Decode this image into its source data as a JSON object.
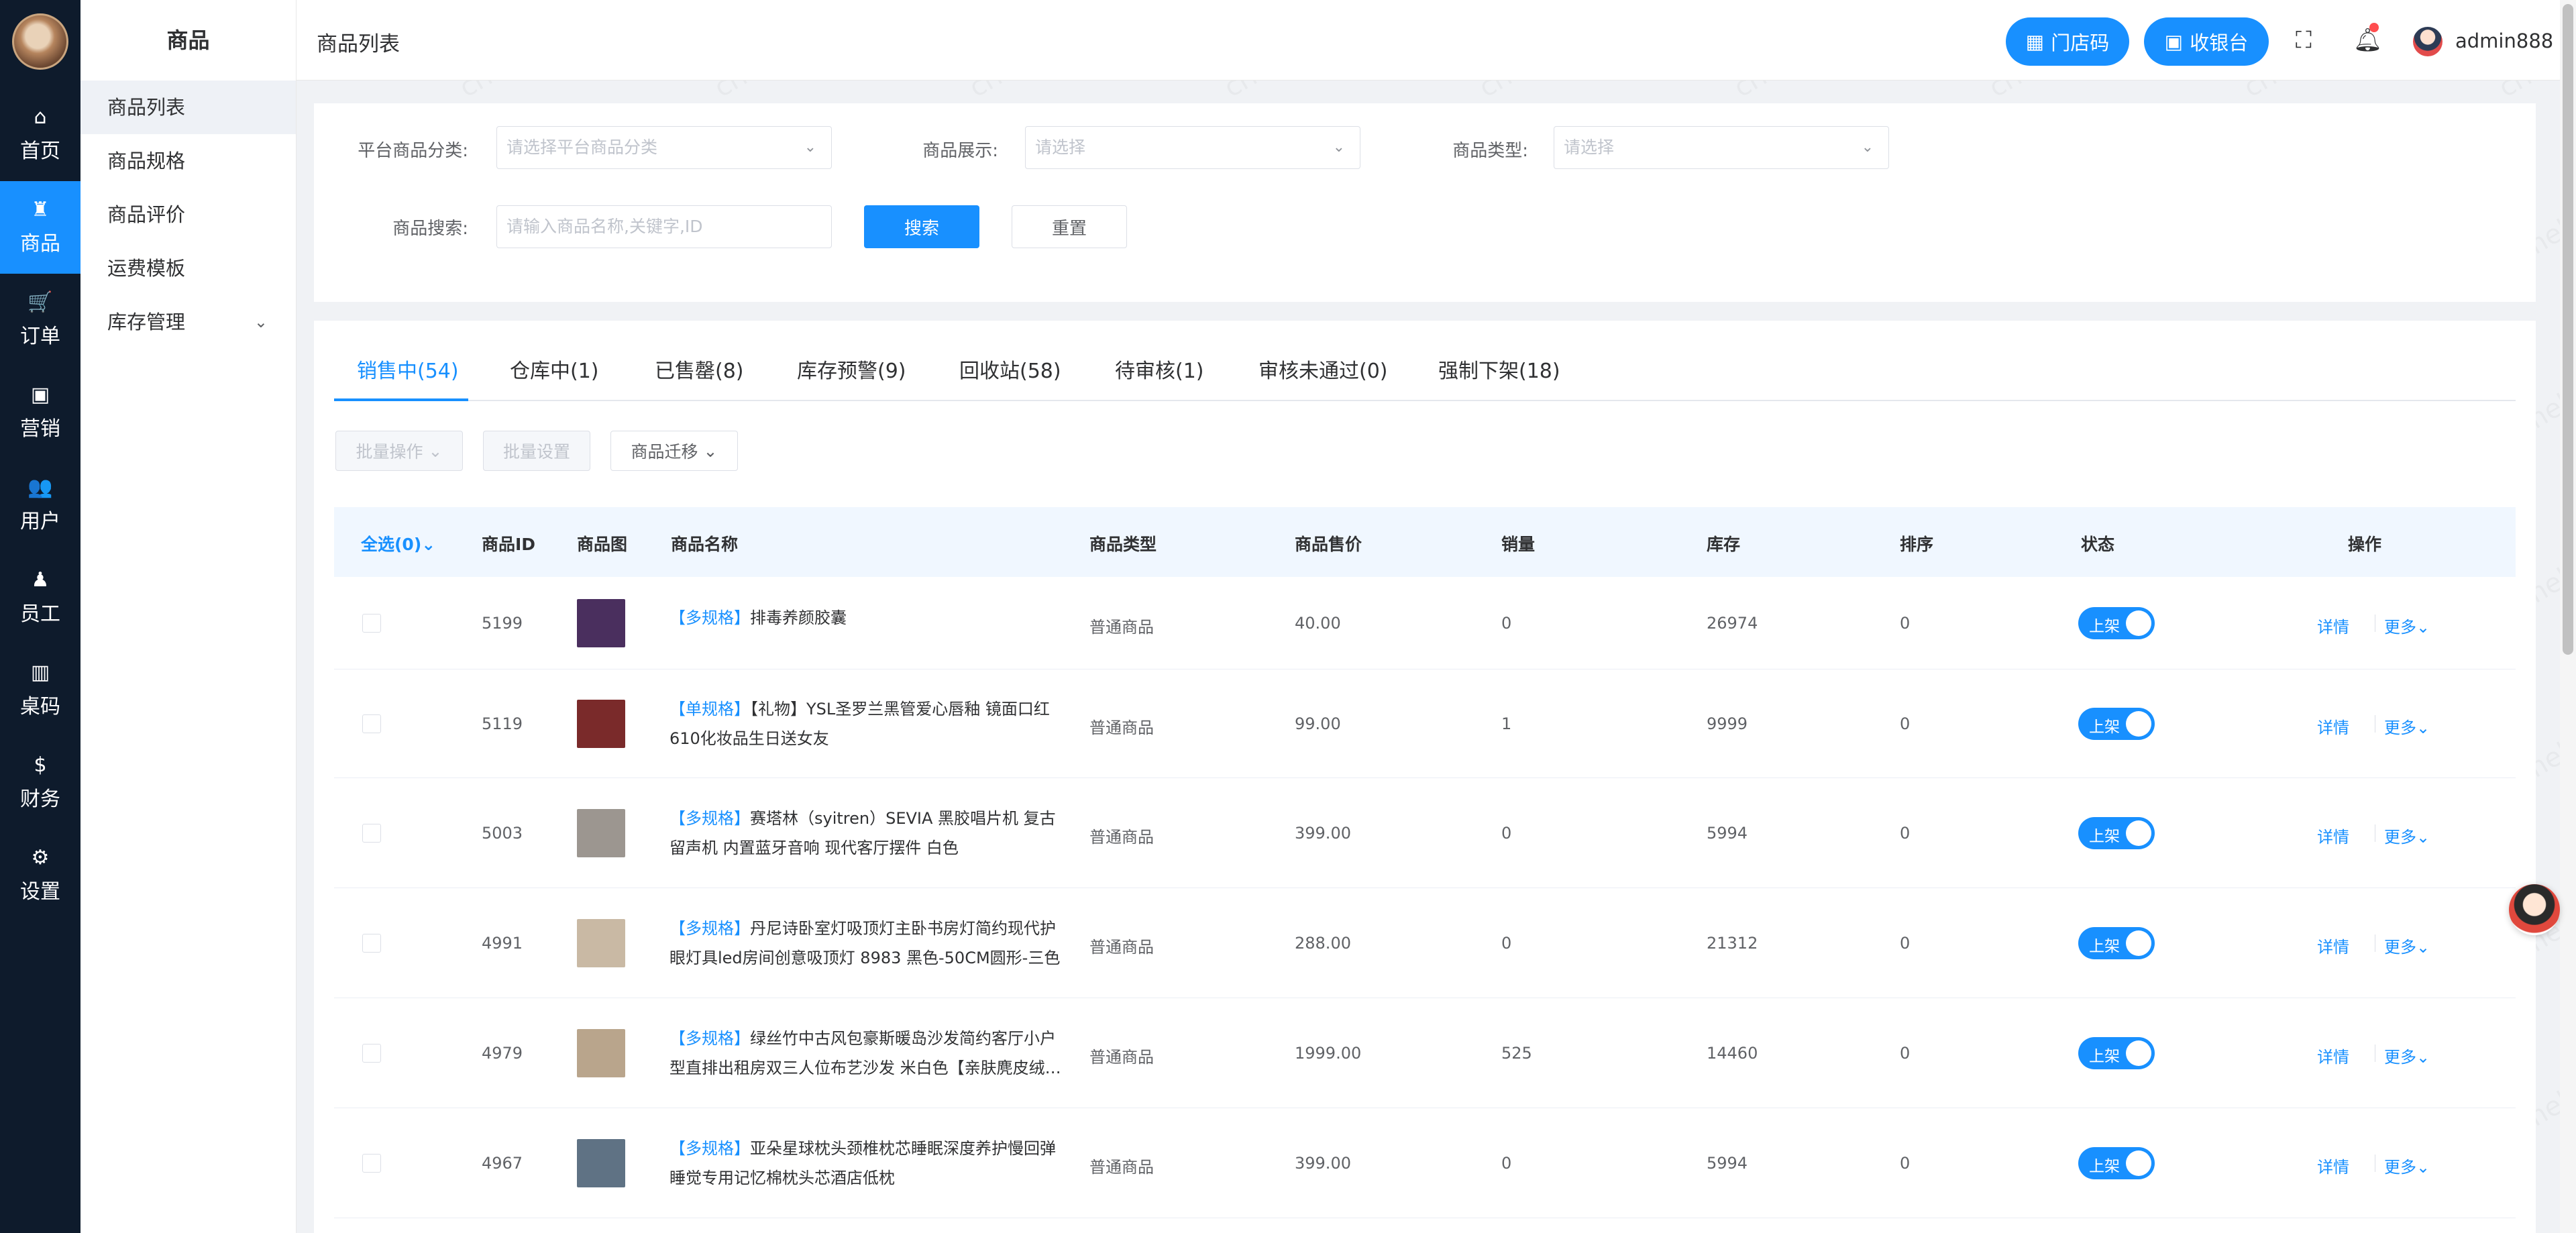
{
  "main_nav": {
    "items": [
      {
        "label": "首页",
        "icon": "⌂"
      },
      {
        "label": "商品",
        "icon": "♜"
      },
      {
        "label": "订单",
        "icon": "🛒"
      },
      {
        "label": "营销",
        "icon": "▣"
      },
      {
        "label": "用户",
        "icon": "👥"
      },
      {
        "label": "员工",
        "icon": "♟"
      },
      {
        "label": "桌码",
        "icon": "▥"
      },
      {
        "label": "财务",
        "icon": "$"
      },
      {
        "label": "设置",
        "icon": "⚙"
      }
    ],
    "active": "商品"
  },
  "sub_nav": {
    "title": "商品",
    "items": [
      "商品列表",
      "商品规格",
      "商品评价",
      "运费模板",
      "库存管理"
    ]
  },
  "header": {
    "breadcrumb": "商品列表",
    "store_code_label": "门店码",
    "cashier_label": "收银台",
    "username": "admin888"
  },
  "filters": {
    "category_label": "平台商品分类:",
    "category_placeholder": "请选择平台商品分类",
    "display_label": "商品展示:",
    "display_placeholder": "请选择",
    "type_label": "商品类型:",
    "type_placeholder": "请选择",
    "search_label": "商品搜索:",
    "search_placeholder": "请输入商品名称,关键字,ID",
    "search_button": "搜索",
    "reset_button": "重置"
  },
  "tabs": [
    "销售中(54)",
    "仓库中(1)",
    "已售罄(8)",
    "库存预警(9)",
    "回收站(58)",
    "待审核(1)",
    "审核未通过(0)",
    "强制下架(18)"
  ],
  "actions": {
    "batch_op": "批量操作",
    "batch_set": "批量设置",
    "migrate": "商品迁移"
  },
  "table": {
    "headers": [
      "全选(0)",
      "商品ID",
      "商品图",
      "商品名称",
      "商品类型",
      "商品售价",
      "销量",
      "库存",
      "排序",
      "状态",
      "操作"
    ],
    "rows": [
      {
        "id": "5199",
        "tag": "【多规格】",
        "name": "排毒养颜胶囊",
        "type": "普通商品",
        "price": "40.00",
        "sales": "0",
        "stock": "26974",
        "sort": "0",
        "status": "上架",
        "thumb_color": "#4a2f5e"
      },
      {
        "id": "5119",
        "tag": "【单规格】",
        "name": "【礼物】YSL圣罗兰黑管爱心唇釉 镜面口红610化妆品生日送女友",
        "type": "普通商品",
        "price": "99.00",
        "sales": "1",
        "stock": "9999",
        "sort": "0",
        "status": "上架",
        "thumb_color": "#7a2a2a"
      },
      {
        "id": "5003",
        "tag": "【多规格】",
        "name": "赛塔林（syitren）SEVIA 黑胶唱片机 复古留声机 内置蓝牙音响 现代客厅摆件 白色",
        "type": "普通商品",
        "price": "399.00",
        "sales": "0",
        "stock": "5994",
        "sort": "0",
        "status": "上架",
        "thumb_color": "#9c9690"
      },
      {
        "id": "4991",
        "tag": "【多规格】",
        "name": "丹尼诗卧室灯吸顶灯主卧书房灯简约现代护眼灯具led房间创意吸顶灯 8983 黑色-50CM圆形-三色",
        "type": "普通商品",
        "price": "288.00",
        "sales": "0",
        "stock": "21312",
        "sort": "0",
        "status": "上架",
        "thumb_color": "#c9b9a4"
      },
      {
        "id": "4979",
        "tag": "【多规格】",
        "name": "绿丝竹中古风包豪斯暖岛沙发简约客厅小户型直排出租房双三人位布艺沙发 米白色【亲肤麂皮绒…",
        "type": "普通商品",
        "price": "1999.00",
        "sales": "525",
        "stock": "14460",
        "sort": "0",
        "status": "上架",
        "thumb_color": "#b9a58c"
      },
      {
        "id": "4967",
        "tag": "【多规格】",
        "name": "亚朵星球枕头颈椎枕芯睡眠深度养护慢回弹睡觉专用记忆棉枕头芯酒店低枕",
        "type": "普通商品",
        "price": "399.00",
        "sales": "0",
        "stock": "5994",
        "sort": "0",
        "status": "上架",
        "thumb_color": "#5f7284"
      }
    ],
    "op_detail": "详情",
    "op_more": "更多"
  },
  "watermark": "crmeb"
}
